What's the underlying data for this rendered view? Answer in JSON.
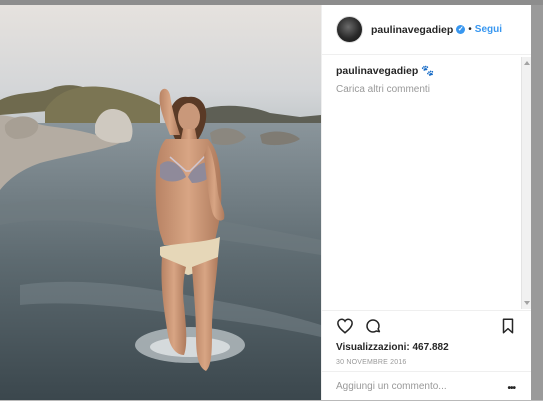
{
  "post": {
    "username": "paulinavegadiep",
    "verified_mark": "✓",
    "separator": "•",
    "follow_label": "Segui",
    "caption_username": "paulinavegadiep",
    "caption_text": "🐾",
    "load_more": "Carica altri commenti",
    "views": "Visualizzazioni: 467.882",
    "date": "30 NOVEMBRE 2016",
    "comment_placeholder": "Aggiungi un commento...",
    "more_glyph": "•••"
  },
  "icons": {
    "like": "heart-icon",
    "comment": "comment-bubble-icon",
    "save": "bookmark-icon",
    "more": "ellipsis-icon"
  },
  "colors": {
    "link_blue": "#3897f0",
    "text_dark": "#262626",
    "text_muted": "#999999"
  }
}
